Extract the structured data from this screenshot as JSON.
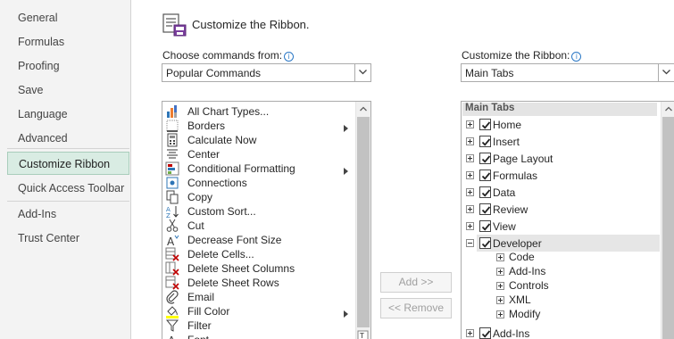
{
  "sidebar": {
    "items": [
      {
        "label": "General"
      },
      {
        "label": "Formulas"
      },
      {
        "label": "Proofing"
      },
      {
        "label": "Save"
      },
      {
        "label": "Language"
      },
      {
        "label": "Advanced"
      },
      {
        "label": "Customize Ribbon",
        "active": true
      },
      {
        "label": "Quick Access Toolbar"
      },
      {
        "label": "Add-Ins"
      },
      {
        "label": "Trust Center"
      }
    ]
  },
  "header": {
    "title": "Customize the Ribbon.",
    "icon": "customize-ribbon-icon"
  },
  "left": {
    "label": "Choose commands from:",
    "dropdown_value": "Popular Commands",
    "commands": [
      {
        "label": "All Chart Types...",
        "icon": "chart-icon"
      },
      {
        "label": "Borders",
        "icon": "borders-icon",
        "submenu": true
      },
      {
        "label": "Calculate Now",
        "icon": "calculator-icon"
      },
      {
        "label": "Center",
        "icon": "align-center-icon"
      },
      {
        "label": "Conditional Formatting",
        "icon": "conditional-formatting-icon",
        "submenu": true
      },
      {
        "label": "Connections",
        "icon": "connections-icon"
      },
      {
        "label": "Copy",
        "icon": "copy-icon"
      },
      {
        "label": "Custom Sort...",
        "icon": "sort-icon"
      },
      {
        "label": "Cut",
        "icon": "scissors-icon"
      },
      {
        "label": "Decrease Font Size",
        "icon": "decrease-font-icon"
      },
      {
        "label": "Delete Cells...",
        "icon": "delete-cells-icon"
      },
      {
        "label": "Delete Sheet Columns",
        "icon": "delete-columns-icon"
      },
      {
        "label": "Delete Sheet Rows",
        "icon": "delete-rows-icon"
      },
      {
        "label": "Email",
        "icon": "attachment-icon"
      },
      {
        "label": "Fill Color",
        "icon": "fill-color-icon",
        "submenu": true
      },
      {
        "label": "Filter",
        "icon": "filter-icon"
      },
      {
        "label": "Font",
        "icon": "font-icon"
      }
    ]
  },
  "buttons": {
    "add": "Add >>",
    "remove": "<< Remove"
  },
  "right": {
    "label": "Customize the Ribbon:",
    "dropdown_value": "Main Tabs",
    "tree_header": "Main Tabs",
    "tabs": [
      {
        "label": "Home",
        "checked": true,
        "expanded": false
      },
      {
        "label": "Insert",
        "checked": true,
        "expanded": false
      },
      {
        "label": "Page Layout",
        "checked": true,
        "expanded": false
      },
      {
        "label": "Formulas",
        "checked": true,
        "expanded": false
      },
      {
        "label": "Data",
        "checked": true,
        "expanded": false
      },
      {
        "label": "Review",
        "checked": true,
        "expanded": false
      },
      {
        "label": "View",
        "checked": true,
        "expanded": false
      },
      {
        "label": "Developer",
        "checked": true,
        "expanded": true,
        "selected": true,
        "groups": [
          "Code",
          "Add-Ins",
          "Controls",
          "XML",
          "Modify"
        ]
      },
      {
        "label": "Add-Ins",
        "checked": true,
        "expanded": false
      }
    ]
  }
}
